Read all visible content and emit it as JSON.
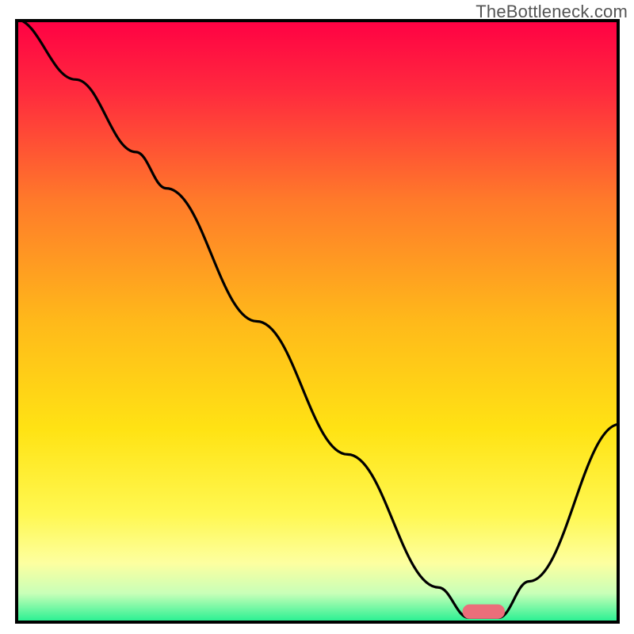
{
  "watermark": "TheBottleneck.com",
  "colors": {
    "gradient": [
      {
        "offset": 0,
        "hex": "#ff0044"
      },
      {
        "offset": 12,
        "hex": "#ff2a3e"
      },
      {
        "offset": 30,
        "hex": "#ff7a2a"
      },
      {
        "offset": 50,
        "hex": "#ffb91a"
      },
      {
        "offset": 68,
        "hex": "#ffe314"
      },
      {
        "offset": 82,
        "hex": "#fff852"
      },
      {
        "offset": 90,
        "hex": "#fdffa0"
      },
      {
        "offset": 95,
        "hex": "#c8ffb8"
      },
      {
        "offset": 100,
        "hex": "#1bef8f"
      }
    ],
    "curve": "#000000",
    "marker": "#eb6e7a"
  },
  "chart_data": {
    "type": "line",
    "title": "",
    "xlabel": "",
    "ylabel": "",
    "xlim": [
      0,
      100
    ],
    "ylim": [
      0,
      100
    ],
    "curve": {
      "x": [
        0,
        10,
        20,
        25,
        40,
        55,
        70,
        75,
        80,
        85,
        100
      ],
      "y": [
        100,
        90,
        78,
        72,
        50,
        28,
        6,
        1,
        1,
        7,
        33
      ]
    },
    "flat_minimum": {
      "x_start": 74,
      "x_end": 80,
      "y": 1
    },
    "marker": {
      "x_center": 77.5,
      "width": 7,
      "y": 2,
      "height": 2.4
    }
  }
}
